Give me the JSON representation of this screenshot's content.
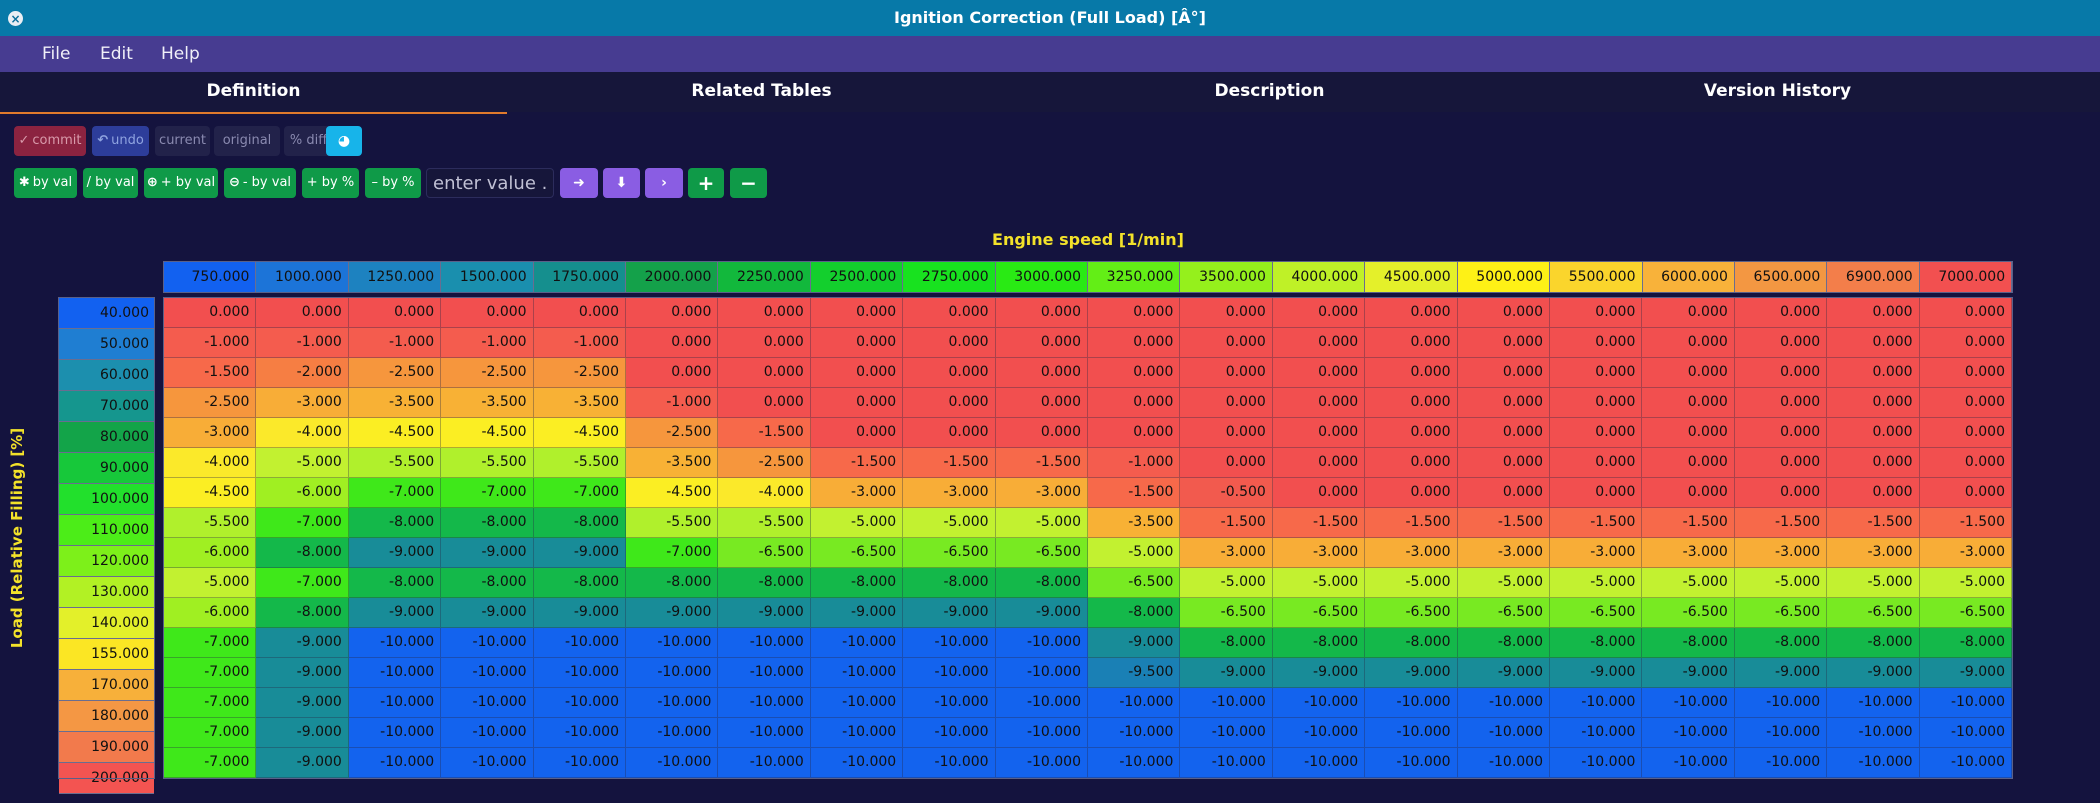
{
  "window": {
    "title": "Ignition Correction (Full Load) [Â°]"
  },
  "menu": {
    "file": "File",
    "edit": "Edit",
    "help": "Help"
  },
  "tabs": [
    "Definition",
    "Related Tables",
    "Description",
    "Version History"
  ],
  "toolbar": {
    "commit": "commit",
    "undo": "undo",
    "current": "current",
    "original": "original",
    "diff": "% diff"
  },
  "ops": {
    "mul_by_val": "by val",
    "div_by_val": "/ by val",
    "add_by_val": "+ by val",
    "sub_by_val": "- by val",
    "add_by_pct": "+ by %",
    "sub_by_pct": "– by %",
    "value_placeholder": "enter value .."
  },
  "icons": {
    "close": "close-icon",
    "commit": "check-icon",
    "undo": "undo-arrow-icon",
    "chart": "pie-chart-icon",
    "mul": "asterisk-icon",
    "add": "plus-circle-icon",
    "sub": "minus-circle-icon",
    "fill_right": "arrow-right-icon",
    "fill_down": "arrow-down-icon",
    "interpolate": "chevron-right-icon",
    "increment": "plus-icon",
    "decrement": "minus-icon"
  },
  "table": {
    "x_label": "Engine speed [1/min]",
    "y_label": "Load (Relative Filling) [%]",
    "x_axis": [
      "750.000",
      "1000.000",
      "1250.000",
      "1500.000",
      "1750.000",
      "2000.000",
      "2250.000",
      "2500.000",
      "2750.000",
      "3000.000",
      "3250.000",
      "3500.000",
      "4000.000",
      "4500.000",
      "5000.000",
      "5500.000",
      "6000.000",
      "6500.000",
      "6900.000",
      "7000.000"
    ],
    "y_axis": [
      "40.000",
      "50.000",
      "60.000",
      "70.000",
      "80.000",
      "90.000",
      "100.000",
      "110.000",
      "120.000",
      "130.000",
      "140.000",
      "155.000",
      "170.000",
      "180.000",
      "190.000",
      "200.000"
    ],
    "axis_colors": {
      "x": [
        "#1261f0",
        "#1c74d8",
        "#1d82c0",
        "#1a8fae",
        "#158f8e",
        "#14a14a",
        "#12b83c",
        "#13cf2d",
        "#18e21f",
        "#29ea14",
        "#63ee16",
        "#95f01c",
        "#bff127",
        "#e4f02a",
        "#fef116",
        "#fad52c",
        "#f8b23a",
        "#f39742",
        "#f37e4a",
        "#f25050"
      ],
      "y": [
        "#1261f0",
        "#1f7ed2",
        "#1c8fae",
        "#15968e",
        "#13a449",
        "#17c83a",
        "#22e02c",
        "#4ced18",
        "#7df01a",
        "#b2f124",
        "#e3f02a",
        "#fbe624",
        "#f7b03a",
        "#f49744",
        "#f27a4c",
        "#f35451"
      ]
    },
    "values": [
      [
        "0.000",
        "0.000",
        "0.000",
        "0.000",
        "0.000",
        "0.000",
        "0.000",
        "0.000",
        "0.000",
        "0.000",
        "0.000",
        "0.000",
        "0.000",
        "0.000",
        "0.000",
        "0.000",
        "0.000",
        "0.000",
        "0.000",
        "0.000"
      ],
      [
        "-1.000",
        "-1.000",
        "-1.000",
        "-1.000",
        "-1.000",
        "0.000",
        "0.000",
        "0.000",
        "0.000",
        "0.000",
        "0.000",
        "0.000",
        "0.000",
        "0.000",
        "0.000",
        "0.000",
        "0.000",
        "0.000",
        "0.000",
        "0.000"
      ],
      [
        "-1.500",
        "-2.000",
        "-2.500",
        "-2.500",
        "-2.500",
        "0.000",
        "0.000",
        "0.000",
        "0.000",
        "0.000",
        "0.000",
        "0.000",
        "0.000",
        "0.000",
        "0.000",
        "0.000",
        "0.000",
        "0.000",
        "0.000",
        "0.000"
      ],
      [
        "-2.500",
        "-3.000",
        "-3.500",
        "-3.500",
        "-3.500",
        "-1.000",
        "0.000",
        "0.000",
        "0.000",
        "0.000",
        "0.000",
        "0.000",
        "0.000",
        "0.000",
        "0.000",
        "0.000",
        "0.000",
        "0.000",
        "0.000",
        "0.000"
      ],
      [
        "-3.000",
        "-4.000",
        "-4.500",
        "-4.500",
        "-4.500",
        "-2.500",
        "-1.500",
        "0.000",
        "0.000",
        "0.000",
        "0.000",
        "0.000",
        "0.000",
        "0.000",
        "0.000",
        "0.000",
        "0.000",
        "0.000",
        "0.000",
        "0.000"
      ],
      [
        "-4.000",
        "-5.000",
        "-5.500",
        "-5.500",
        "-5.500",
        "-3.500",
        "-2.500",
        "-1.500",
        "-1.500",
        "-1.500",
        "-1.000",
        "0.000",
        "0.000",
        "0.000",
        "0.000",
        "0.000",
        "0.000",
        "0.000",
        "0.000",
        "0.000"
      ],
      [
        "-4.500",
        "-6.000",
        "-7.000",
        "-7.000",
        "-7.000",
        "-4.500",
        "-4.000",
        "-3.000",
        "-3.000",
        "-3.000",
        "-1.500",
        "-0.500",
        "0.000",
        "0.000",
        "0.000",
        "0.000",
        "0.000",
        "0.000",
        "0.000",
        "0.000"
      ],
      [
        "-5.500",
        "-7.000",
        "-8.000",
        "-8.000",
        "-8.000",
        "-5.500",
        "-5.500",
        "-5.000",
        "-5.000",
        "-5.000",
        "-3.500",
        "-1.500",
        "-1.500",
        "-1.500",
        "-1.500",
        "-1.500",
        "-1.500",
        "-1.500",
        "-1.500",
        "-1.500"
      ],
      [
        "-6.000",
        "-8.000",
        "-9.000",
        "-9.000",
        "-9.000",
        "-7.000",
        "-6.500",
        "-6.500",
        "-6.500",
        "-6.500",
        "-5.000",
        "-3.000",
        "-3.000",
        "-3.000",
        "-3.000",
        "-3.000",
        "-3.000",
        "-3.000",
        "-3.000",
        "-3.000"
      ],
      [
        "-5.000",
        "-7.000",
        "-8.000",
        "-8.000",
        "-8.000",
        "-8.000",
        "-8.000",
        "-8.000",
        "-8.000",
        "-8.000",
        "-6.500",
        "-5.000",
        "-5.000",
        "-5.000",
        "-5.000",
        "-5.000",
        "-5.000",
        "-5.000",
        "-5.000",
        "-5.000"
      ],
      [
        "-6.000",
        "-8.000",
        "-9.000",
        "-9.000",
        "-9.000",
        "-9.000",
        "-9.000",
        "-9.000",
        "-9.000",
        "-9.000",
        "-8.000",
        "-6.500",
        "-6.500",
        "-6.500",
        "-6.500",
        "-6.500",
        "-6.500",
        "-6.500",
        "-6.500",
        "-6.500"
      ],
      [
        "-7.000",
        "-9.000",
        "-10.000",
        "-10.000",
        "-10.000",
        "-10.000",
        "-10.000",
        "-10.000",
        "-10.000",
        "-10.000",
        "-9.000",
        "-8.000",
        "-8.000",
        "-8.000",
        "-8.000",
        "-8.000",
        "-8.000",
        "-8.000",
        "-8.000",
        "-8.000"
      ],
      [
        "-7.000",
        "-9.000",
        "-10.000",
        "-10.000",
        "-10.000",
        "-10.000",
        "-10.000",
        "-10.000",
        "-10.000",
        "-10.000",
        "-9.500",
        "-9.000",
        "-9.000",
        "-9.000",
        "-9.000",
        "-9.000",
        "-9.000",
        "-9.000",
        "-9.000",
        "-9.000"
      ],
      [
        "-7.000",
        "-9.000",
        "-10.000",
        "-10.000",
        "-10.000",
        "-10.000",
        "-10.000",
        "-10.000",
        "-10.000",
        "-10.000",
        "-10.000",
        "-10.000",
        "-10.000",
        "-10.000",
        "-10.000",
        "-10.000",
        "-10.000",
        "-10.000",
        "-10.000",
        "-10.000"
      ],
      [
        "-7.000",
        "-9.000",
        "-10.000",
        "-10.000",
        "-10.000",
        "-10.000",
        "-10.000",
        "-10.000",
        "-10.000",
        "-10.000",
        "-10.000",
        "-10.000",
        "-10.000",
        "-10.000",
        "-10.000",
        "-10.000",
        "-10.000",
        "-10.000",
        "-10.000",
        "-10.000"
      ],
      [
        "-7.000",
        "-9.000",
        "-10.000",
        "-10.000",
        "-10.000",
        "-10.000",
        "-10.000",
        "-10.000",
        "-10.000",
        "-10.000",
        "-10.000",
        "-10.000",
        "-10.000",
        "-10.000",
        "-10.000",
        "-10.000",
        "-10.000",
        "-10.000",
        "-10.000",
        "-10.000"
      ]
    ],
    "value_colors": {
      "0.000": "#f24f4f",
      "-0.500": "#f25a4e",
      "-1.000": "#f45c4e",
      "-1.500": "#f7694a",
      "-2.000": "#f67e43",
      "-2.500": "#f6963d",
      "-3.000": "#f8ad37",
      "-3.500": "#f8b135",
      "-4.000": "#fbe92a",
      "-4.500": "#fbee23",
      "-5.000": "#c2f130",
      "-5.500": "#b0f02c",
      "-6.000": "#a0ef22",
      "-6.500": "#78ea22",
      "-7.000": "#3fe81a",
      "-8.000": "#14b84a",
      "-9.000": "#188c98",
      "-9.500": "#1a80b5",
      "-10.000": "#1363ee"
    }
  }
}
